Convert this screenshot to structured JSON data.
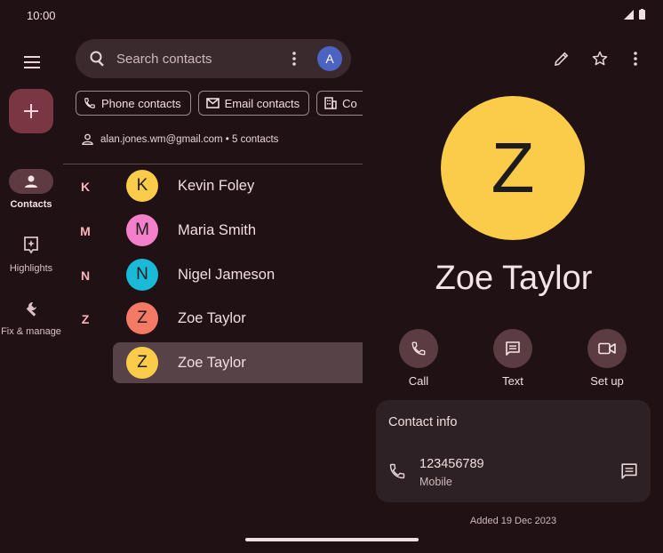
{
  "status": {
    "time": "10:00"
  },
  "nav": {
    "items": [
      {
        "label": "Contacts",
        "icon": "person-icon"
      },
      {
        "label": "Highlights",
        "icon": "highlights-icon"
      },
      {
        "label": "Fix & manage",
        "icon": "wrench-icon"
      }
    ]
  },
  "search": {
    "placeholder": "Search contacts",
    "avatar_initial": "A"
  },
  "filters": [
    "Phone contacts",
    "Email contacts",
    "Co"
  ],
  "account": {
    "text": "alan.jones.wm@gmail.com • 5 contacts"
  },
  "contacts": {
    "letters": [
      "K",
      "M",
      "N",
      "Z"
    ],
    "rows": [
      {
        "initial": "K",
        "name": "Kevin Foley",
        "color": "#fbcb4a"
      },
      {
        "initial": "M",
        "name": "Maria Smith",
        "color": "#f47fcb"
      },
      {
        "initial": "N",
        "name": "Nigel Jameson",
        "color": "#19b9d7"
      },
      {
        "initial": "Z",
        "name": "Zoe Taylor",
        "color": "#f47a66"
      },
      {
        "initial": "Z",
        "name": "Zoe Taylor",
        "color": "#fbcb4a"
      }
    ]
  },
  "detail": {
    "initial": "Z",
    "name": "Zoe Taylor",
    "avatar_color": "#fbcb4a",
    "actions": [
      {
        "label": "Call",
        "icon": "phone-icon"
      },
      {
        "label": "Text",
        "icon": "message-icon"
      },
      {
        "label": "Set up",
        "icon": "video-icon"
      }
    ],
    "card": {
      "title": "Contact info",
      "number": "123456789",
      "type": "Mobile"
    },
    "added": "Added 19 Dec 2023"
  },
  "colors": {
    "background": "#1f1114",
    "accent": "#ffb2bd",
    "fab": "#7b3644"
  }
}
